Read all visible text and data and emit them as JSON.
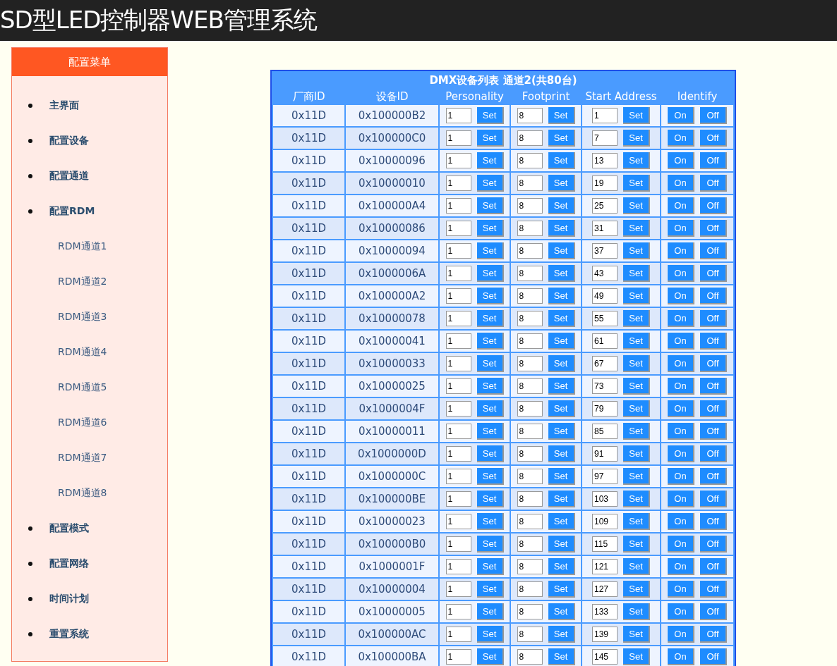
{
  "header": {
    "title": "SD型LED控制器WEB管理系统"
  },
  "sidebar": {
    "title": "配置菜单",
    "items": [
      {
        "label": "主界面"
      },
      {
        "label": "配置设备"
      },
      {
        "label": "配置通道"
      },
      {
        "label": "配置RDM",
        "children": [
          {
            "label": "RDM通道1"
          },
          {
            "label": "RDM通道2"
          },
          {
            "label": "RDM通道3"
          },
          {
            "label": "RDM通道4"
          },
          {
            "label": "RDM通道5"
          },
          {
            "label": "RDM通道6"
          },
          {
            "label": "RDM通道7"
          },
          {
            "label": "RDM通道8"
          }
        ]
      },
      {
        "label": "配置模式"
      },
      {
        "label": "配置网络"
      },
      {
        "label": "时间计划"
      },
      {
        "label": "重置系统"
      }
    ]
  },
  "table": {
    "title": "DMX设备列表 通道2(共80台)",
    "columns": [
      "厂商ID",
      "设备ID",
      "Personality",
      "Footprint",
      "Start Address",
      "Identify"
    ],
    "rows": [
      {
        "vendor_id": "0x11D",
        "device_id": "0x100000B2",
        "personality": "1",
        "personality_button": "Set",
        "footprint": "8",
        "footprint_button": "Set",
        "start_address": "1",
        "start_address_button": "Set",
        "identify_on": "On",
        "identify_off": "Off"
      },
      {
        "vendor_id": "0x11D",
        "device_id": "0x100000C0",
        "personality": "1",
        "personality_button": "Set",
        "footprint": "8",
        "footprint_button": "Set",
        "start_address": "7",
        "start_address_button": "Set",
        "identify_on": "On",
        "identify_off": "Off"
      },
      {
        "vendor_id": "0x11D",
        "device_id": "0x10000096",
        "personality": "1",
        "personality_button": "Set",
        "footprint": "8",
        "footprint_button": "Set",
        "start_address": "13",
        "start_address_button": "Set",
        "identify_on": "On",
        "identify_off": "Off"
      },
      {
        "vendor_id": "0x11D",
        "device_id": "0x10000010",
        "personality": "1",
        "personality_button": "Set",
        "footprint": "8",
        "footprint_button": "Set",
        "start_address": "19",
        "start_address_button": "Set",
        "identify_on": "On",
        "identify_off": "Off"
      },
      {
        "vendor_id": "0x11D",
        "device_id": "0x100000A4",
        "personality": "1",
        "personality_button": "Set",
        "footprint": "8",
        "footprint_button": "Set",
        "start_address": "25",
        "start_address_button": "Set",
        "identify_on": "On",
        "identify_off": "Off"
      },
      {
        "vendor_id": "0x11D",
        "device_id": "0x10000086",
        "personality": "1",
        "personality_button": "Set",
        "footprint": "8",
        "footprint_button": "Set",
        "start_address": "31",
        "start_address_button": "Set",
        "identify_on": "On",
        "identify_off": "Off"
      },
      {
        "vendor_id": "0x11D",
        "device_id": "0x10000094",
        "personality": "1",
        "personality_button": "Set",
        "footprint": "8",
        "footprint_button": "Set",
        "start_address": "37",
        "start_address_button": "Set",
        "identify_on": "On",
        "identify_off": "Off"
      },
      {
        "vendor_id": "0x11D",
        "device_id": "0x1000006A",
        "personality": "1",
        "personality_button": "Set",
        "footprint": "8",
        "footprint_button": "Set",
        "start_address": "43",
        "start_address_button": "Set",
        "identify_on": "On",
        "identify_off": "Off"
      },
      {
        "vendor_id": "0x11D",
        "device_id": "0x100000A2",
        "personality": "1",
        "personality_button": "Set",
        "footprint": "8",
        "footprint_button": "Set",
        "start_address": "49",
        "start_address_button": "Set",
        "identify_on": "On",
        "identify_off": "Off"
      },
      {
        "vendor_id": "0x11D",
        "device_id": "0x10000078",
        "personality": "1",
        "personality_button": "Set",
        "footprint": "8",
        "footprint_button": "Set",
        "start_address": "55",
        "start_address_button": "Set",
        "identify_on": "On",
        "identify_off": "Off"
      },
      {
        "vendor_id": "0x11D",
        "device_id": "0x10000041",
        "personality": "1",
        "personality_button": "Set",
        "footprint": "8",
        "footprint_button": "Set",
        "start_address": "61",
        "start_address_button": "Set",
        "identify_on": "On",
        "identify_off": "Off"
      },
      {
        "vendor_id": "0x11D",
        "device_id": "0x10000033",
        "personality": "1",
        "personality_button": "Set",
        "footprint": "8",
        "footprint_button": "Set",
        "start_address": "67",
        "start_address_button": "Set",
        "identify_on": "On",
        "identify_off": "Off"
      },
      {
        "vendor_id": "0x11D",
        "device_id": "0x10000025",
        "personality": "1",
        "personality_button": "Set",
        "footprint": "8",
        "footprint_button": "Set",
        "start_address": "73",
        "start_address_button": "Set",
        "identify_on": "On",
        "identify_off": "Off"
      },
      {
        "vendor_id": "0x11D",
        "device_id": "0x1000004F",
        "personality": "1",
        "personality_button": "Set",
        "footprint": "8",
        "footprint_button": "Set",
        "start_address": "79",
        "start_address_button": "Set",
        "identify_on": "On",
        "identify_off": "Off"
      },
      {
        "vendor_id": "0x11D",
        "device_id": "0x10000011",
        "personality": "1",
        "personality_button": "Set",
        "footprint": "8",
        "footprint_button": "Set",
        "start_address": "85",
        "start_address_button": "Set",
        "identify_on": "On",
        "identify_off": "Off"
      },
      {
        "vendor_id": "0x11D",
        "device_id": "0x1000000D",
        "personality": "1",
        "personality_button": "Set",
        "footprint": "8",
        "footprint_button": "Set",
        "start_address": "91",
        "start_address_button": "Set",
        "identify_on": "On",
        "identify_off": "Off"
      },
      {
        "vendor_id": "0x11D",
        "device_id": "0x1000000C",
        "personality": "1",
        "personality_button": "Set",
        "footprint": "8",
        "footprint_button": "Set",
        "start_address": "97",
        "start_address_button": "Set",
        "identify_on": "On",
        "identify_off": "Off"
      },
      {
        "vendor_id": "0x11D",
        "device_id": "0x100000BE",
        "personality": "1",
        "personality_button": "Set",
        "footprint": "8",
        "footprint_button": "Set",
        "start_address": "103",
        "start_address_button": "Set",
        "identify_on": "On",
        "identify_off": "Off"
      },
      {
        "vendor_id": "0x11D",
        "device_id": "0x10000023",
        "personality": "1",
        "personality_button": "Set",
        "footprint": "8",
        "footprint_button": "Set",
        "start_address": "109",
        "start_address_button": "Set",
        "identify_on": "On",
        "identify_off": "Off"
      },
      {
        "vendor_id": "0x11D",
        "device_id": "0x100000B0",
        "personality": "1",
        "personality_button": "Set",
        "footprint": "8",
        "footprint_button": "Set",
        "start_address": "115",
        "start_address_button": "Set",
        "identify_on": "On",
        "identify_off": "Off"
      },
      {
        "vendor_id": "0x11D",
        "device_id": "0x1000001F",
        "personality": "1",
        "personality_button": "Set",
        "footprint": "8",
        "footprint_button": "Set",
        "start_address": "121",
        "start_address_button": "Set",
        "identify_on": "On",
        "identify_off": "Off"
      },
      {
        "vendor_id": "0x11D",
        "device_id": "0x10000004",
        "personality": "1",
        "personality_button": "Set",
        "footprint": "8",
        "footprint_button": "Set",
        "start_address": "127",
        "start_address_button": "Set",
        "identify_on": "On",
        "identify_off": "Off"
      },
      {
        "vendor_id": "0x11D",
        "device_id": "0x10000005",
        "personality": "1",
        "personality_button": "Set",
        "footprint": "8",
        "footprint_button": "Set",
        "start_address": "133",
        "start_address_button": "Set",
        "identify_on": "On",
        "identify_off": "Off"
      },
      {
        "vendor_id": "0x11D",
        "device_id": "0x100000AC",
        "personality": "1",
        "personality_button": "Set",
        "footprint": "8",
        "footprint_button": "Set",
        "start_address": "139",
        "start_address_button": "Set",
        "identify_on": "On",
        "identify_off": "Off"
      },
      {
        "vendor_id": "0x11D",
        "device_id": "0x100000BA",
        "personality": "1",
        "personality_button": "Set",
        "footprint": "8",
        "footprint_button": "Set",
        "start_address": "145",
        "start_address_button": "Set",
        "identify_on": "On",
        "identify_off": "Off"
      }
    ]
  }
}
